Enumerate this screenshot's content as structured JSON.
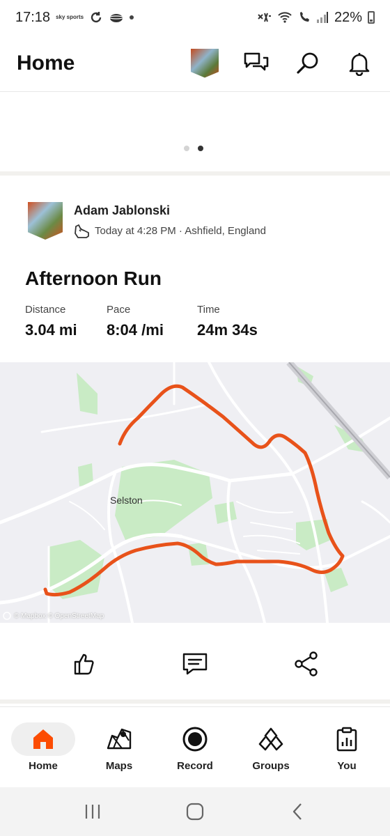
{
  "status_bar": {
    "time": "17:18",
    "carrier_logo": "sky sports",
    "battery": "22%",
    "icons": [
      "sync-icon",
      "cloud-icon",
      "notification-dot",
      "vibrate-icon",
      "wifi-icon",
      "wifi-calling-icon",
      "signal-icon",
      "battery-icon"
    ]
  },
  "header": {
    "title": "Home",
    "icons": [
      "profile-avatar",
      "chat-icon",
      "search-icon",
      "bell-icon"
    ]
  },
  "carousel": {
    "page_count": 2,
    "active_page": 2
  },
  "activity": {
    "athlete_name": "Adam Jablonski",
    "meta": "Today at 4:28 PM · Ashfield, England",
    "sport_icon": "shoe-icon",
    "title": "Afternoon Run",
    "stats": [
      {
        "label": "Distance",
        "value": "3.04 mi"
      },
      {
        "label": "Pace",
        "value": "8:04 /mi"
      },
      {
        "label": "Time",
        "value": "24m 34s"
      }
    ],
    "map": {
      "place_label": "Selston",
      "attribution": "© Mapbox © OpenStreetMap",
      "route_color": "#e8521a"
    }
  },
  "actions": [
    "like-icon",
    "comment-icon",
    "share-icon"
  ],
  "nav": {
    "items": [
      {
        "label": "Home",
        "icon": "home-icon",
        "active": true
      },
      {
        "label": "Maps",
        "icon": "map-icon",
        "active": false
      },
      {
        "label": "Record",
        "icon": "record-icon",
        "active": false
      },
      {
        "label": "Groups",
        "icon": "groups-icon",
        "active": false
      },
      {
        "label": "You",
        "icon": "profile-stats-icon",
        "active": false
      }
    ],
    "accent_color": "#fc4c02"
  },
  "system_nav": [
    "recents-icon",
    "home-circle-icon",
    "back-icon"
  ]
}
